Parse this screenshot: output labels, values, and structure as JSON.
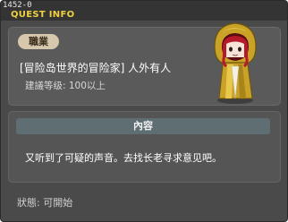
{
  "quest": {
    "id": "1452-0",
    "window_title": "QUEST INFO",
    "job_label": "職業",
    "name": "[冒险岛世界的冒险家] 人外有人",
    "level_requirement": "建議等级: 100以上",
    "content_header": "內容",
    "content_text": "又听到了可疑的声音。去找长老寻求意见吧。",
    "status": "狀態: 可開始"
  },
  "colors": {
    "title": "#f0d040",
    "window_bg": "#4a4a4a",
    "badge_bg": "#d7c7ad",
    "content_header_bg": "#5f6e72"
  },
  "icons": {
    "npc": "hooded-npc-portrait"
  }
}
